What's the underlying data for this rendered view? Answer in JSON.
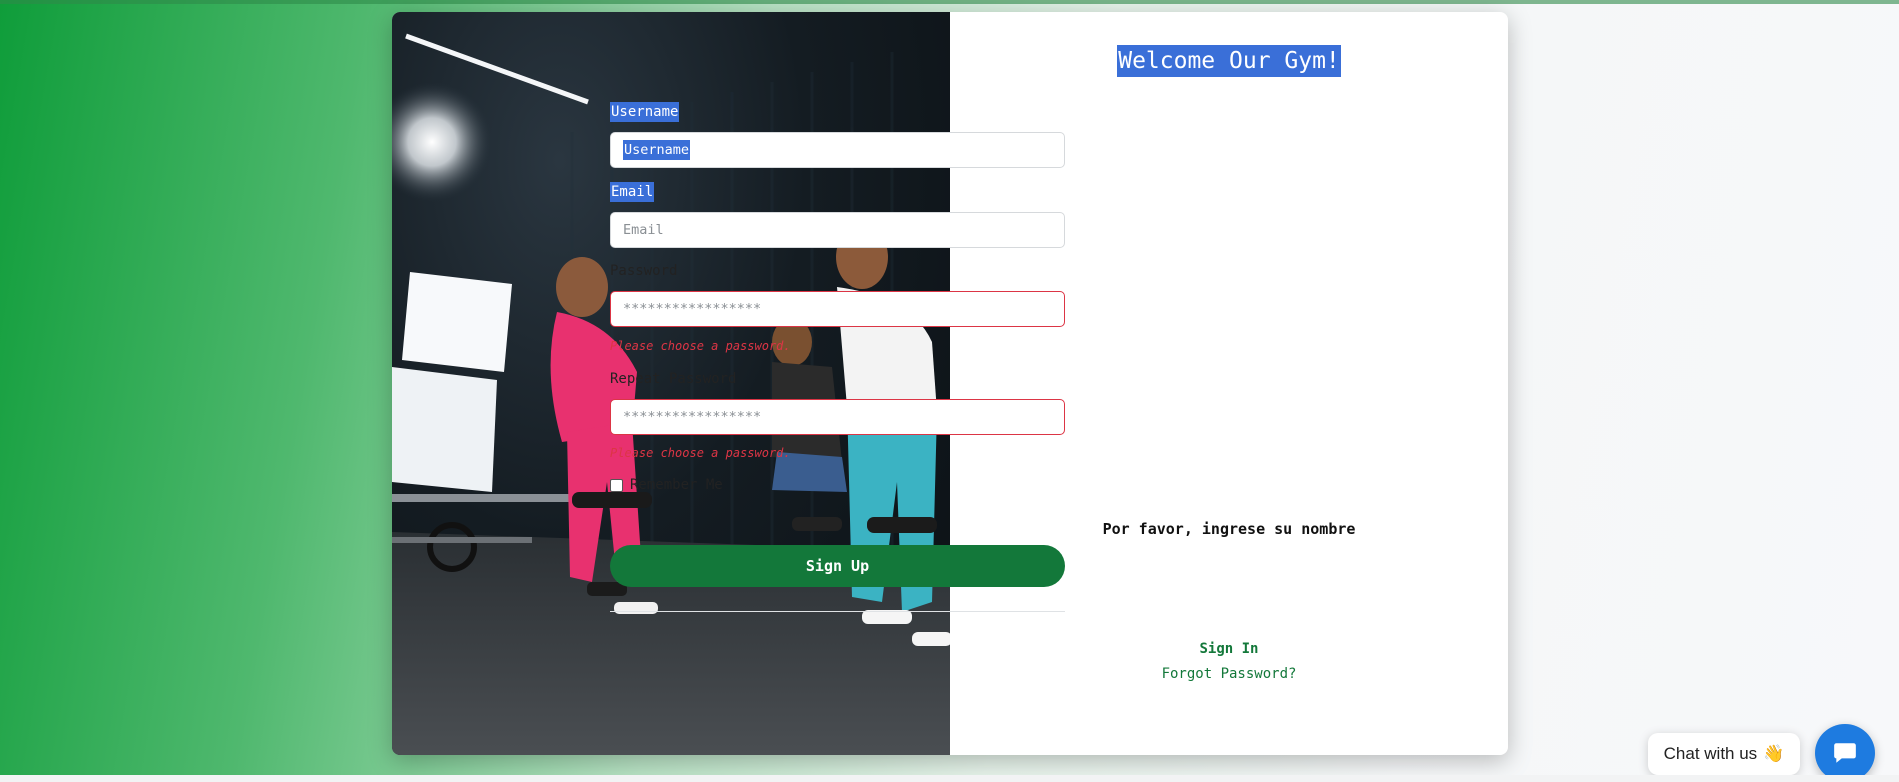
{
  "form": {
    "title": "Welcome Our Gym!",
    "username_label": "Username",
    "username_placeholder": "Username",
    "email_label": "Email",
    "email_placeholder": "Email",
    "password_label": "Password",
    "password_placeholder": "*****************",
    "password_error": "Please choose a password.",
    "repeat_password_label": "Repeat Password",
    "repeat_password_placeholder": "*****************",
    "repeat_password_error": "Please choose a password.",
    "remember_label": "Remember Me",
    "notice": "Por favor, ingrese su nombre",
    "signup_label": "Sign Up",
    "signin_label": "Sign In",
    "forgot_label": "Forgot Password?"
  },
  "chat": {
    "pill_label": "Chat with us",
    "pill_emoji": "👋",
    "icon": "chat-bubble-icon"
  },
  "colors": {
    "accent_green": "#13783a",
    "error_red": "#dc3545",
    "selection_blue": "#3a6fd8",
    "chat_blue": "#1e7be0"
  }
}
